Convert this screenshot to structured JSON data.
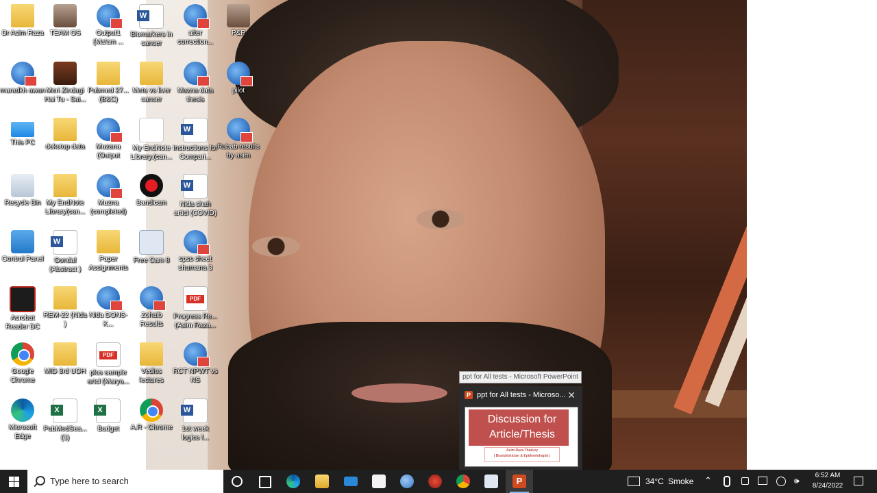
{
  "desktop": {
    "icons": [
      {
        "label": "Dr Asim Raza",
        "kind": "folder"
      },
      {
        "label": "maradkh awan",
        "kind": "spss"
      },
      {
        "label": "This PC",
        "kind": "pc"
      },
      {
        "label": "Recycle Bin",
        "kind": "recycle"
      },
      {
        "label": "Control Panel",
        "kind": "control"
      },
      {
        "label": "Acrobat Reader DC",
        "kind": "acrobat"
      },
      {
        "label": "Google Chrome",
        "kind": "chrome"
      },
      {
        "label": "Microsoft Edge",
        "kind": "edge"
      },
      {
        "label": "TEAM OS",
        "kind": "photo"
      },
      {
        "label": "Meri Zindagi Hai Tu - Sai...",
        "kind": "film"
      },
      {
        "label": "dekstop data",
        "kind": "folder"
      },
      {
        "label": "My EndNote Library(can...",
        "kind": "folder"
      },
      {
        "label": "Gondal (Abstract )",
        "kind": "word"
      },
      {
        "label": "REM-22 (Nida )",
        "kind": "folder"
      },
      {
        "label": "MID 3rd UOH",
        "kind": "folder"
      },
      {
        "label": "PubMedSea... (1)",
        "kind": "excel"
      },
      {
        "label": "Output1 (Ma'am ...",
        "kind": "spss"
      },
      {
        "label": "Pubmed 27... (B&C)",
        "kind": "folder"
      },
      {
        "label": "Muzana (Output",
        "kind": "spss"
      },
      {
        "label": "Muzna (completed)",
        "kind": "spss"
      },
      {
        "label": "Paper Assignments",
        "kind": "folder"
      },
      {
        "label": "Nida DONS-K...",
        "kind": "spss"
      },
      {
        "label": "plos sample artcl (Marya...",
        "kind": "pdf"
      },
      {
        "label": "Budget",
        "kind": "excel"
      },
      {
        "label": "Biomarkers in cancer",
        "kind": "word"
      },
      {
        "label": "Mets vs liver cancer",
        "kind": "folder"
      },
      {
        "label": "My EndNote Library.(can...",
        "kind": "blank"
      },
      {
        "label": "Bandicam",
        "kind": "bandicam"
      },
      {
        "label": "Free Cam 8",
        "kind": "freecam"
      },
      {
        "label": "Zohaib Results",
        "kind": "spss"
      },
      {
        "label": "Vedios lectures",
        "kind": "folder"
      },
      {
        "label": "A.R - Chrome",
        "kind": "chrome"
      },
      {
        "label": "after correction...",
        "kind": "spss"
      },
      {
        "label": "Muzna data thesis",
        "kind": "spss"
      },
      {
        "label": "instructions for Compari...",
        "kind": "word"
      },
      {
        "label": "Nida shah articl (COVID)",
        "kind": "word"
      },
      {
        "label": "spss sheet shumana 3",
        "kind": "spss"
      },
      {
        "label": "Progress Re... (Asim Raza...",
        "kind": "pdf"
      },
      {
        "label": "RCT NPWT vs NS",
        "kind": "spss"
      },
      {
        "label": "1st week logics f...",
        "kind": "word"
      },
      {
        "label": "P&P",
        "kind": "photo"
      },
      {
        "label": "pilot",
        "kind": "spss"
      },
      {
        "label": "Rubab results by asim",
        "kind": "spss"
      }
    ]
  },
  "preview": {
    "tooltip": "ppt for All tests - Microsoft PowerPoint",
    "window_title": "ppt for All tests - Microso...",
    "close_glyph": "✕",
    "app_badge": "P",
    "slide_title_line1": "Discussion for",
    "slide_title_line2": "Article/Thesis",
    "slide_author": "Asim Raza Thakury",
    "slide_role": "( Biostatistician & Epidemiologist )"
  },
  "taskbar": {
    "search_placeholder": "Type here to search",
    "weather_temp": "34°C",
    "weather_desc": "Smoke",
    "time": "6:52 AM",
    "date": "8/24/2022",
    "pinned": [
      "edge",
      "file-explorer",
      "mail",
      "store",
      "globe-app",
      "game-app",
      "chrome",
      "image-viewer",
      "powerpoint"
    ]
  },
  "colors": {
    "taskbar": "#1f1f1f",
    "slide_title_bg": "#c0504d",
    "powerpoint": "#d04a1f"
  }
}
